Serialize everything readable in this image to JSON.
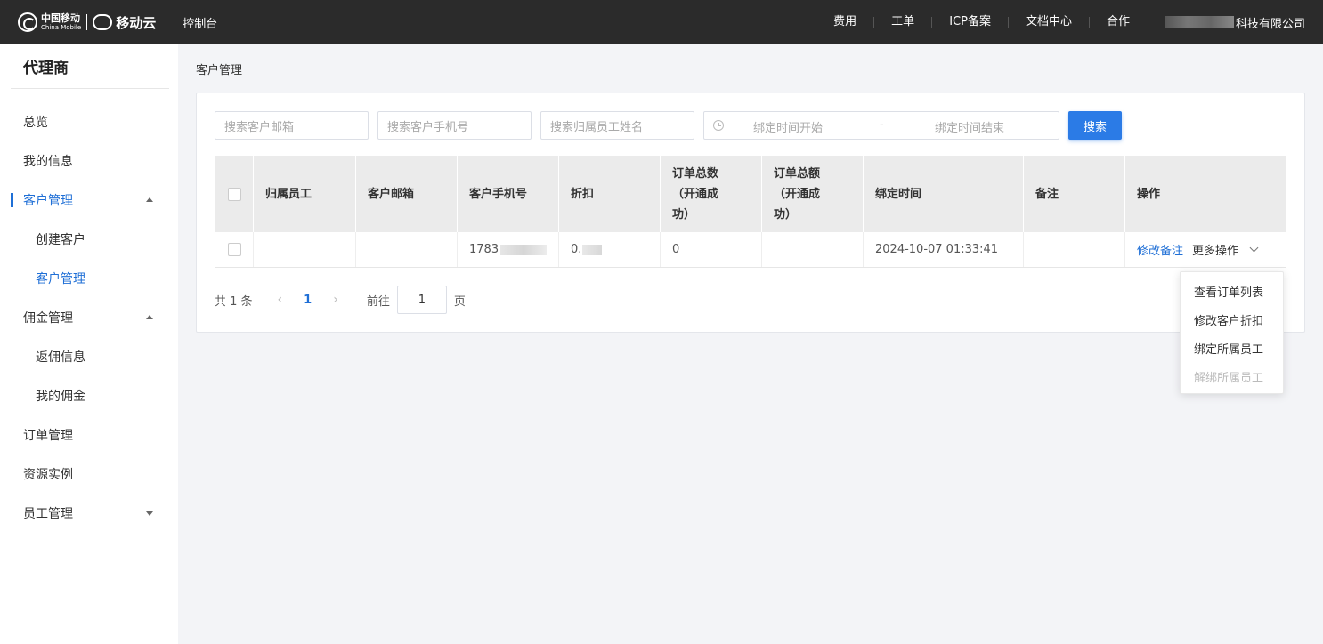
{
  "topbar": {
    "brand_cn": "中国移动",
    "brand_en": "China Mobile",
    "brand_cloud": "移动云",
    "console": "控制台",
    "nav": [
      "费用",
      "工单",
      "ICP备案",
      "文档中心",
      "合作"
    ],
    "company_suffix": "科技有限公司"
  },
  "sidebar": {
    "title": "代理商",
    "items": [
      {
        "label": "总览"
      },
      {
        "label": "我的信息"
      },
      {
        "label": "客户管理",
        "expanded": true,
        "active": true
      },
      {
        "label": "创建客户"
      },
      {
        "label": "客户管理"
      },
      {
        "label": "佣金管理",
        "expanded": true
      },
      {
        "label": "返佣信息"
      },
      {
        "label": "我的佣金"
      },
      {
        "label": "订单管理"
      },
      {
        "label": "资源实例"
      },
      {
        "label": "员工管理",
        "expanded": false
      }
    ]
  },
  "breadcrumb": "客户管理",
  "filters": {
    "email_placeholder": "搜索客户邮箱",
    "phone_placeholder": "搜索客户手机号",
    "employee_placeholder": "搜索归属员工姓名",
    "date_start_placeholder": "绑定时间开始",
    "date_separator": "-",
    "date_end_placeholder": "绑定时间结束",
    "search_label": "搜索"
  },
  "table": {
    "headers": [
      "归属员工",
      "客户邮箱",
      "客户手机号",
      "折扣",
      "订单总数\n（开通成\n功）",
      "订单总额\n（开通成\n功）",
      "绑定时间",
      "备注",
      "操作"
    ],
    "rows": [
      {
        "employee": "",
        "email": "",
        "phone": "1783",
        "discount": "0.",
        "order_count": "0",
        "order_total": "",
        "bind_time": "2024-10-07 01:33:41",
        "remark": "",
        "edit_remark": "修改备注",
        "more_actions": "更多操作"
      }
    ]
  },
  "pagination": {
    "total": "共 1 条",
    "prev": "‹",
    "current": "1",
    "next": "›",
    "goto_label": "前往",
    "goto_value": "1",
    "page_suffix": "页"
  },
  "dropdown": {
    "items": [
      {
        "label": "查看订单列表",
        "disabled": false
      },
      {
        "label": "修改客户折扣",
        "disabled": false
      },
      {
        "label": "绑定所属员工",
        "disabled": false
      },
      {
        "label": "解绑所属员工",
        "disabled": true
      }
    ]
  },
  "colors": {
    "topbar_bg": "#2b2b2b",
    "accent": "#1f6fd6",
    "button": "#2b7be6",
    "page_bg": "#f3f4f7"
  }
}
